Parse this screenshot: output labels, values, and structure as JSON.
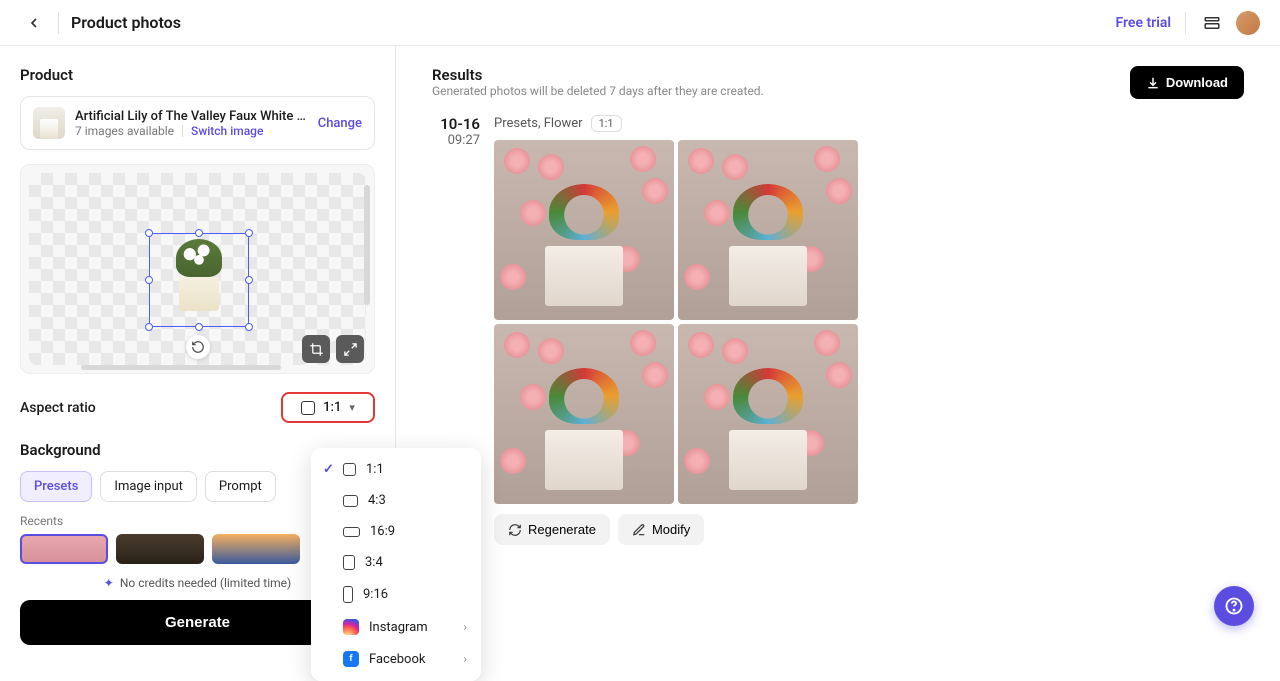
{
  "header": {
    "title": "Product photos",
    "free_trial": "Free trial"
  },
  "left": {
    "product_section": "Product",
    "product_name": "Artificial Lily of The Valley Faux White Be...",
    "images_available": "7 images available",
    "switch_image": "Switch image",
    "change": "Change",
    "aspect_ratio_label": "Aspect ratio",
    "aspect_ratio_value": "1:1",
    "background_label": "Background",
    "tabs": {
      "presets": "Presets",
      "image_input": "Image input",
      "prompt": "Prompt"
    },
    "recents_label": "Recents",
    "credits_note": "No credits needed (limited time)",
    "generate": "Generate"
  },
  "dropdown": {
    "r11": "1:1",
    "r43": "4:3",
    "r169": "16:9",
    "r34": "3:4",
    "r916": "9:16",
    "instagram": "Instagram",
    "facebook": "Facebook"
  },
  "right": {
    "results_title": "Results",
    "results_sub": "Generated photos will be deleted 7 days after they are created.",
    "download": "Download",
    "date": "10-16",
    "time": "09:27",
    "tags": "Presets, Flower",
    "ratio_badge": "1:1",
    "regenerate": "Regenerate",
    "modify": "Modify"
  }
}
